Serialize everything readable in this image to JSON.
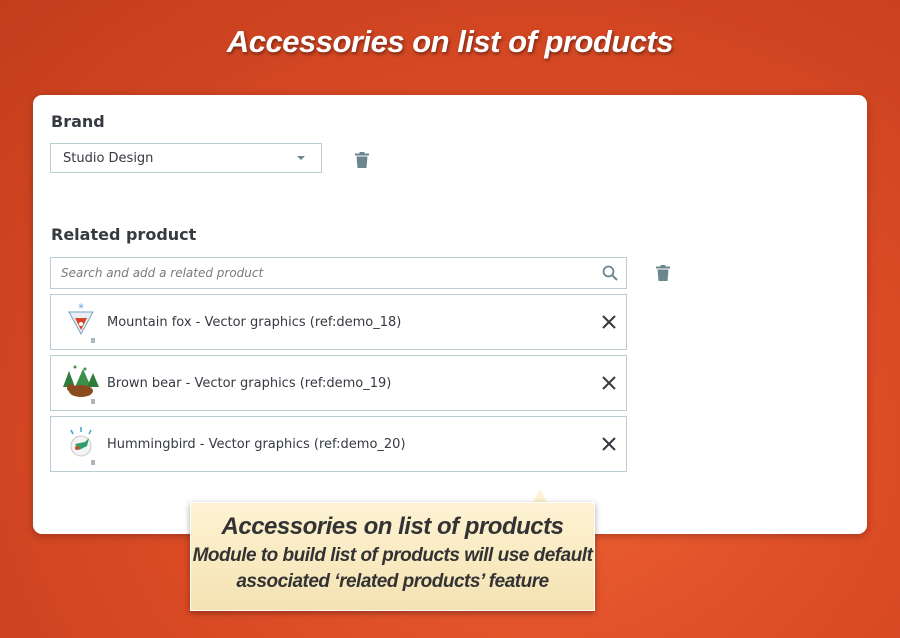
{
  "banner": {
    "title": "Accessories on list of products"
  },
  "brand": {
    "label": "Brand",
    "selected": "Studio Design"
  },
  "related": {
    "label": "Related product",
    "search_placeholder": "Search and add a related product",
    "items": [
      {
        "name": "Mountain fox - Vector graphics (ref:demo_18)",
        "icon": "mountain-fox-thumbnail"
      },
      {
        "name": "Brown bear - Vector graphics (ref:demo_19)",
        "icon": "brown-bear-thumbnail"
      },
      {
        "name": "Hummingbird - Vector graphics (ref:demo_20)",
        "icon": "hummingbird-thumbnail"
      }
    ]
  },
  "callout": {
    "title": "Accessories on list of products",
    "line1": "Module to build list of products will use default",
    "line2": "associated ‘related products’ feature"
  },
  "colors": {
    "background": "#dc4c26",
    "card": "#ffffff",
    "border": "#bbcdd2",
    "text": "#363a41",
    "icon": "#6c868e",
    "callout_bg": "#fdf3d3"
  }
}
